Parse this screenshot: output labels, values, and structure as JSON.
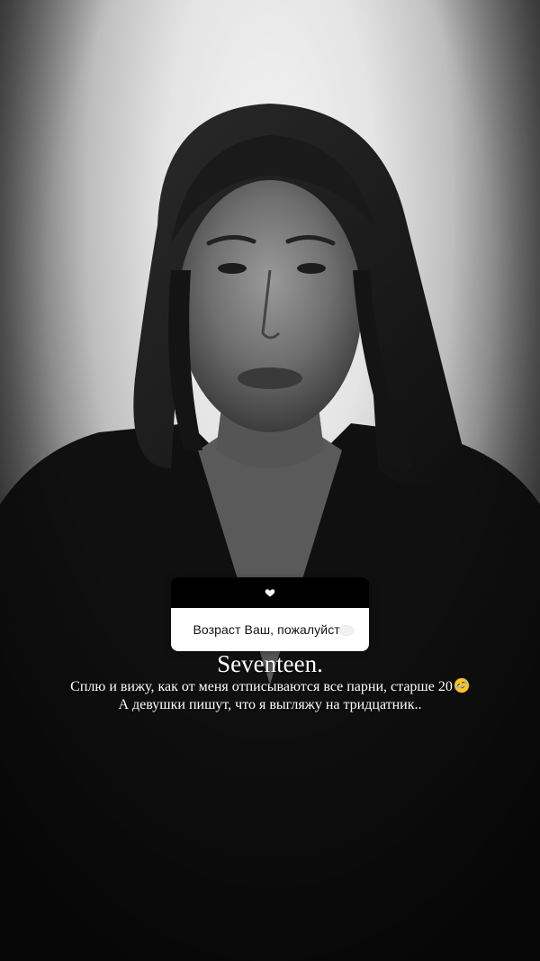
{
  "sticker": {
    "icon": "heart-icon",
    "question": "Возраст Ваш, пожалуйста"
  },
  "caption": {
    "title": "Seventeen.",
    "line1": "Сплю и вижу, как от меня отписываются все парни, старше 20",
    "line1_emoji": "rolling-on-the-floor-laughing-emoji",
    "line2": "А девушки пишут, что я выгляжу на тридцатник.."
  },
  "colors": {
    "sticker_header": "#000000",
    "sticker_body": "#ffffff",
    "caption_text": "#ffffff",
    "emoji": "#f7c531"
  }
}
